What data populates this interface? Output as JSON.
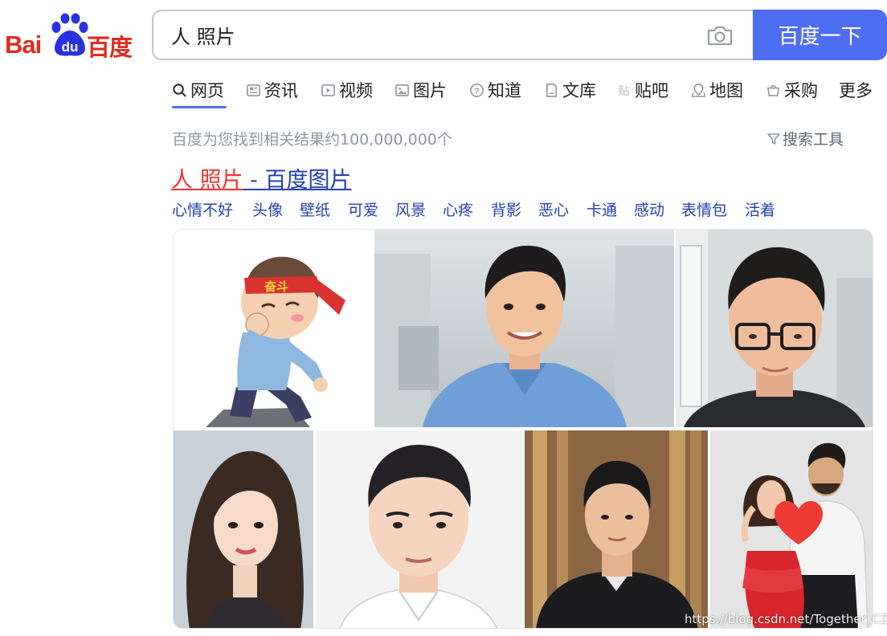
{
  "logo": {
    "text_latin": "Bai",
    "text_du": "du",
    "text_cn": "百度"
  },
  "search": {
    "query": "人 照片",
    "button_label": "百度一下"
  },
  "tabs": [
    {
      "label": "网页",
      "icon": "search-icon",
      "active": true
    },
    {
      "label": "资讯",
      "icon": "news-icon"
    },
    {
      "label": "视频",
      "icon": "video-icon"
    },
    {
      "label": "图片",
      "icon": "image-icon"
    },
    {
      "label": "知道",
      "icon": "question-icon"
    },
    {
      "label": "文库",
      "icon": "document-icon"
    },
    {
      "label": "贴吧",
      "icon": "tieba-icon"
    },
    {
      "label": "地图",
      "icon": "map-icon"
    },
    {
      "label": "采购",
      "icon": "shopping-icon"
    },
    {
      "label": "更多"
    }
  ],
  "results": {
    "count_text": "百度为您找到相关结果约100,000,000个",
    "tools_label": "搜索工具"
  },
  "result": {
    "title_highlight": "人 照片",
    "title_rest": " - 百度图片",
    "tags": [
      "心情不好",
      "头像",
      "壁纸",
      "可爱",
      "风景",
      "心疼",
      "背影",
      "恶心",
      "卡通",
      "感动",
      "表情包",
      "活着"
    ]
  },
  "images": {
    "cartoon_text": "奋斗"
  },
  "watermark": "https://blog.csdn.net/Together_CZ",
  "colors": {
    "brand_red": "#de2c20",
    "brand_blue": "#2932e1",
    "button_blue": "#4e6ef2",
    "link_blue": "#2440b3",
    "highlight_red": "#f73131"
  }
}
